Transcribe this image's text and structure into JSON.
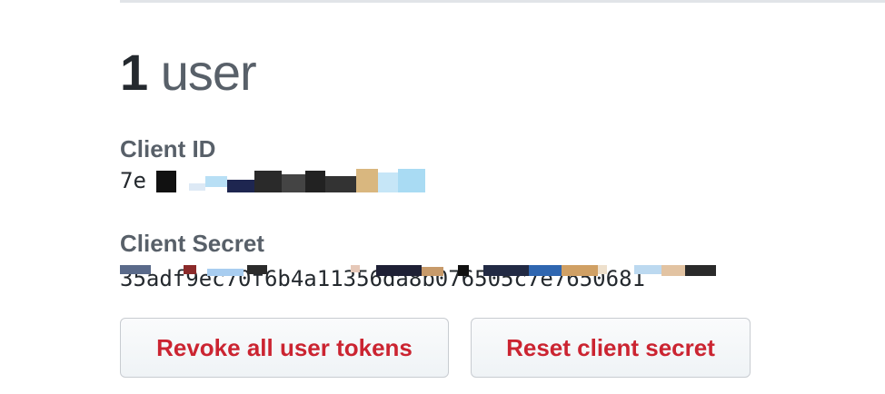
{
  "header": {
    "user_count": "1",
    "user_unit": "user"
  },
  "credentials": {
    "client_id_label": "Client ID",
    "client_id_value": "7e",
    "client_secret_label": "Client Secret",
    "client_secret_value": "35adf9ec70f6b4a11356da8b076505c7e7650681"
  },
  "actions": {
    "revoke_label": "Revoke all user tokens",
    "reset_label": "Reset client secret"
  },
  "colors": {
    "danger_text": "#cb2431",
    "heading_text": "#24292e",
    "muted_text": "#586069",
    "button_border": "#c8ccd1"
  }
}
